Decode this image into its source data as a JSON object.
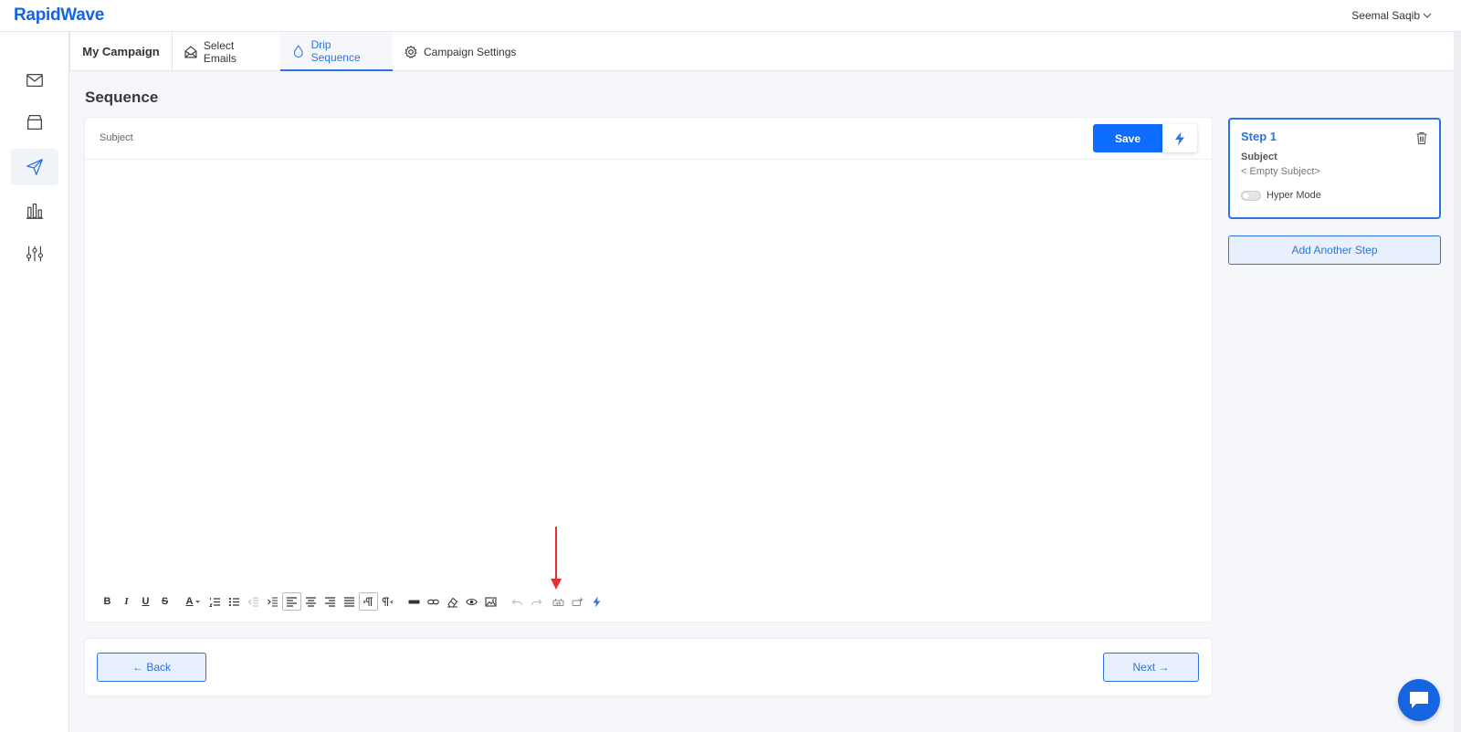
{
  "app": {
    "logo": "RapidWave",
    "user_name": "Seemal Saqib"
  },
  "sidebar": {
    "items": [
      {
        "icon": "mail-icon"
      },
      {
        "icon": "box-icon"
      },
      {
        "icon": "send-icon",
        "active": true
      },
      {
        "icon": "bar-chart-icon"
      },
      {
        "icon": "sliders-icon"
      }
    ]
  },
  "tabs": [
    {
      "label": "My Campaign"
    },
    {
      "label": "Select Emails",
      "icon": "envelope-open-icon"
    },
    {
      "label": "Drip Sequence",
      "icon": "drop-icon",
      "active": true
    },
    {
      "label": "Campaign Settings",
      "icon": "gear-icon"
    }
  ],
  "page": {
    "title": "Sequence"
  },
  "editor": {
    "subject_label": "Subject",
    "save_label": "Save",
    "toolbar": {
      "bold": "B",
      "italic": "I",
      "underline": "U",
      "strike": "S",
      "font_color": "A"
    }
  },
  "nav": {
    "back_label": "← Back",
    "next_label": "Next →"
  },
  "step": {
    "title": "Step 1",
    "subject_label": "Subject",
    "subject_value": "< Empty Subject>",
    "hyper_mode_label": "Hyper Mode",
    "hyper_mode_on": false
  },
  "add_step_label": "Add Another Step",
  "colors": {
    "primary": "#0d6efd",
    "accent": "#2b73e0",
    "annotation_arrow": "#e53030"
  }
}
